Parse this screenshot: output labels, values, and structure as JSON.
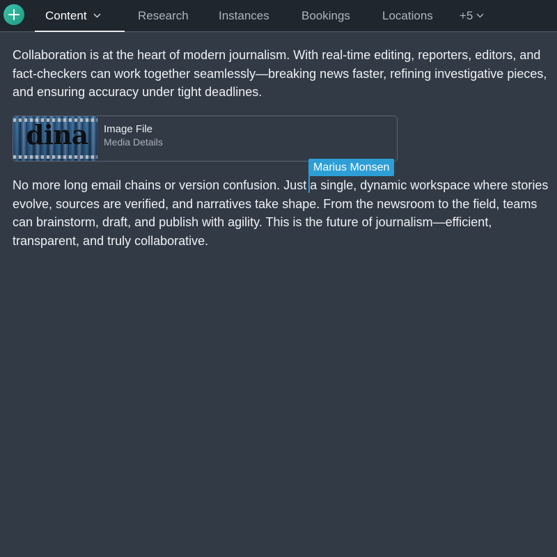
{
  "toolbar": {
    "add_button_icon": "plus-icon",
    "accent_color": "#2bb293"
  },
  "tabs": [
    {
      "label": "Content",
      "active": true,
      "has_dropdown": true
    },
    {
      "label": "Research",
      "active": false
    },
    {
      "label": "Instances",
      "active": false
    },
    {
      "label": "Bookings",
      "active": false
    },
    {
      "label": "Locations",
      "active": false
    },
    {
      "label": "+5",
      "active": false,
      "has_dropdown": true
    }
  ],
  "editor": {
    "paragraph1": "Collaboration is at the heart of modern journalism. With real-time editing, reporters, editors, and fact-checkers can work together seamlessly—breaking news faster, refining investigative pieces, and ensuring accuracy under tight deadlines.",
    "media": {
      "title": "Image File",
      "subtitle": "Media Details",
      "thumbnail_logo": "dina"
    },
    "collaborator_cursor": {
      "name": "Marius Monsen",
      "color": "#2d9fd6"
    },
    "paragraph2": "No more long email chains or version confusion. Just a single, dynamic workspace where stories evolve, sources are verified, and narratives take shape. From the newsroom to the field, teams can brainstorm, draft, and publish with agility. This is the future of journalism—efficient, transparent, and truly collaborative."
  }
}
